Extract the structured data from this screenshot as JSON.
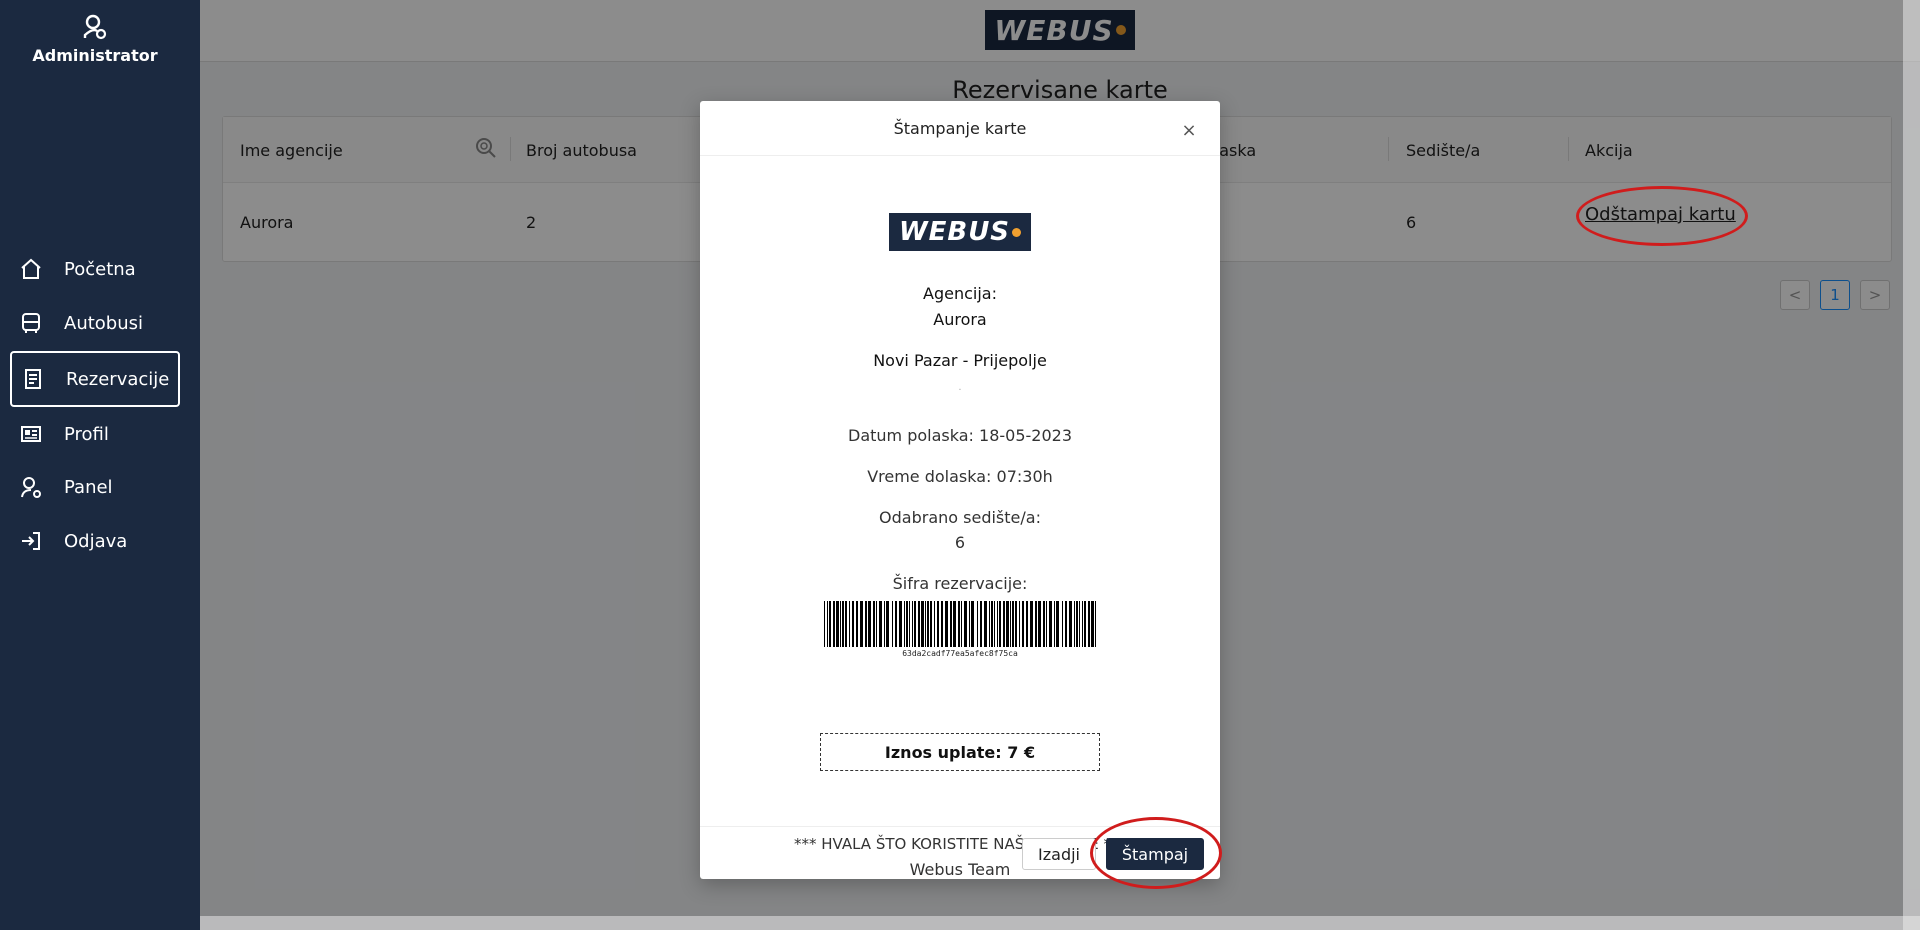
{
  "sidebar": {
    "user_label": "Administrator",
    "items": [
      {
        "label": "Početna",
        "icon": "home-icon"
      },
      {
        "label": "Autobusi",
        "icon": "bus-icon"
      },
      {
        "label": "Rezervacije",
        "icon": "document-icon",
        "active": true
      },
      {
        "label": "Profil",
        "icon": "profile-card-icon"
      },
      {
        "label": "Panel",
        "icon": "admin-user-icon"
      },
      {
        "label": "Odjava",
        "icon": "logout-icon"
      }
    ]
  },
  "header": {
    "logo_text": "WEBUS"
  },
  "page": {
    "title": "Rezervisane karte",
    "table": {
      "columns": [
        "Ime agencije",
        "Broj autobusa",
        "olaska",
        "Sedište/a",
        "Akcija"
      ],
      "rows": [
        {
          "agency": "Aurora",
          "bus_number": "2",
          "seats": "6",
          "action": "Odštampaj kartu"
        }
      ]
    },
    "pagination": {
      "prev": "<",
      "current": "1",
      "next": ">"
    }
  },
  "modal": {
    "title": "Štampanje karte",
    "close": "×",
    "logo_text": "WEBUS",
    "agency_label": "Agencija:",
    "agency_name": "Aurora",
    "route": "Novi Pazar - Prijepolje",
    "dot": ".",
    "departure_date": "Datum polaska: 18-05-2023",
    "arrival_time": "Vreme dolaska: 07:30h",
    "seat_label": "Odabrano sedište/a:",
    "seat_value": "6",
    "code_label": "Šifra rezervacije:",
    "code_value": "63da2cadf77ea5afec8f75ca",
    "amount": "Iznos uplate: 7 €",
    "thanks": "*** HVALA ŠTO KORISTITE NAŠE USLUGE ***",
    "team": "Webus Team",
    "exit_button": "Izadji",
    "print_button": "Štampaj"
  },
  "colors": {
    "sidebar_bg": "#1b2940",
    "logo_dot": "#f0a030",
    "annotation": "#d01c1c",
    "pager_active": "#1890ff"
  }
}
